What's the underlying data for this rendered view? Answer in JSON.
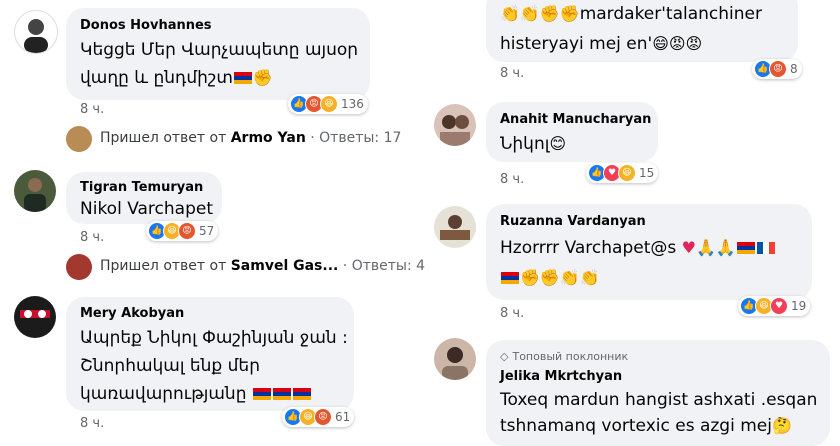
{
  "left": {
    "comments": [
      {
        "name": "Donos Hovhannes",
        "line1": "Կեցցե Մեր Վարչապետը այսօր",
        "line2": "վաղը և ընդմիշտ",
        "time": "8 ч.",
        "count": "136",
        "reply": {
          "prefix": "Пришел ответ от",
          "author": "Armo Yan",
          "suffix": "· Ответы: 17"
        }
      },
      {
        "name": "Tigran Temuryan",
        "line1": "Nikol Varchapet",
        "time": "8 ч.",
        "count": "57",
        "reply": {
          "prefix": "Пришел ответ от",
          "author": "Samvel Gas...",
          "suffix": "· Ответы: 4"
        }
      },
      {
        "name": "Mery Akobyan",
        "line1": "Ապրեք Նիկոլ Փաշինյան ջան :",
        "line2": "Շնորհակալ ենք մեր",
        "line3": "կառավարությանը",
        "time": "8 ч.",
        "count": "61"
      }
    ]
  },
  "right": {
    "comments": [
      {
        "line1": "mardaker'talanchiner",
        "line2": "histeryayi mej en'",
        "time": "8 ч.",
        "count": "8"
      },
      {
        "name": "Anahit Manucharyan",
        "line1": "Նիկոլ",
        "time": "8 ч.",
        "count": "15"
      },
      {
        "name": "Ruzanna Vardanyan",
        "line1": "Hzorrrr Varchapet@s",
        "time": "8 ч.",
        "count": "19"
      },
      {
        "badge": "Топовый поклонник",
        "name": "Jelika Mkrtchyan",
        "line1": "Toxeq mardun hangist ashxati .esqan",
        "line2": "tshnamanq vortexic es azgi mej"
      }
    ]
  },
  "colors": {
    "bubble": "#f0f2f5",
    "meta": "#65676b",
    "like": "#1877f2"
  }
}
